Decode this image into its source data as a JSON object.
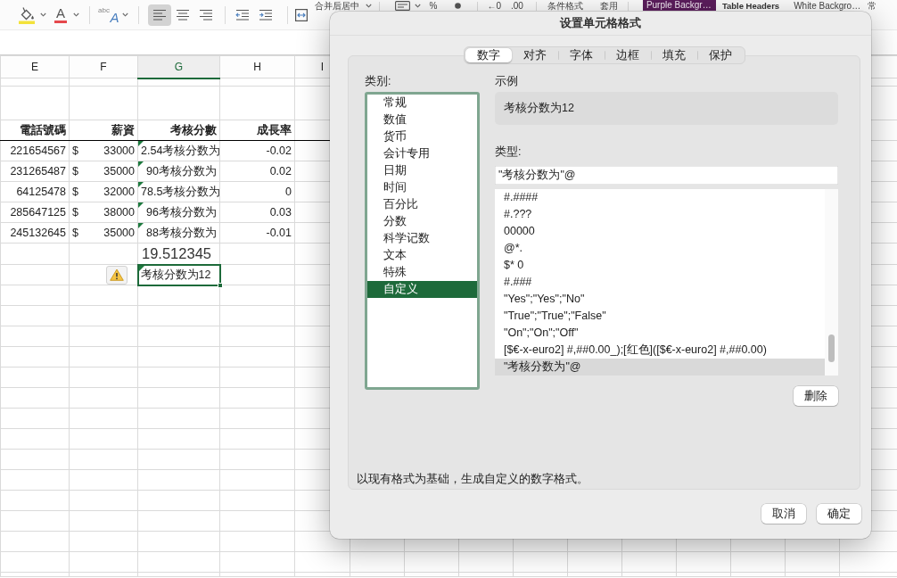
{
  "toolbar": {
    "font_color_glyph": "A",
    "orientation_glyphs": [
      "abc",
      "A"
    ],
    "align_buttons": [
      {
        "selected": true
      },
      {
        "selected": false
      },
      {
        "selected": false
      }
    ],
    "merge_label": "合并后居中",
    "percent_glyph": "%",
    "decimal_labels": [
      "←0",
      ".00"
    ],
    "conditional_format_label": "条件格式",
    "table_format_label": "套用",
    "cell_styles": [
      {
        "label": "Purple Backgr…",
        "kind": "filled"
      },
      {
        "label": "Table Headers",
        "kind": "bold"
      },
      {
        "label": "White Backgro…",
        "kind": "plain"
      },
      {
        "label": "常",
        "kind": "plain"
      }
    ]
  },
  "sheet": {
    "columns": [
      {
        "label": "E",
        "selected": false
      },
      {
        "label": "F",
        "selected": false
      },
      {
        "label": "G",
        "selected": true
      },
      {
        "label": "H",
        "selected": false
      },
      {
        "label": "I",
        "selected": false
      }
    ],
    "header_row": [
      "電話號碼",
      "薪資",
      "考核分數",
      "成長率"
    ],
    "rows": [
      {
        "phone": "221654567",
        "currency": "$",
        "salary": "33000",
        "score": "2.54考核分数为",
        "flagged": true,
        "growth": "-0.02"
      },
      {
        "phone": "231265487",
        "currency": "$",
        "salary": "35000",
        "score": "90考核分数为",
        "flagged": true,
        "growth": "0.02"
      },
      {
        "phone": "64125478",
        "currency": "$",
        "salary": "32000",
        "score": "78.5考核分数为",
        "flagged": true,
        "growth": "0"
      },
      {
        "phone": "285647125",
        "currency": "$",
        "salary": "38000",
        "score": "96考核分数为",
        "flagged": true,
        "growth": "0.03"
      },
      {
        "phone": "245132645",
        "currency": "$",
        "salary": "35000",
        "score": "88考核分数为",
        "flagged": true,
        "growth": "-0.01"
      }
    ],
    "average": "19.512345",
    "active_cell": {
      "text": "考核分数为12",
      "flagged": true,
      "warning": true
    }
  },
  "dialog": {
    "title": "设置单元格格式",
    "tabs": [
      {
        "label": "数字",
        "selected": true
      },
      {
        "label": "对齐",
        "selected": false
      },
      {
        "label": "字体",
        "selected": false
      },
      {
        "label": "边框",
        "selected": false
      },
      {
        "label": "填充",
        "selected": false
      },
      {
        "label": "保护",
        "selected": false
      }
    ],
    "category_label": "类别:",
    "categories": [
      {
        "label": "常规",
        "selected": false
      },
      {
        "label": "数值",
        "selected": false
      },
      {
        "label": "货币",
        "selected": false
      },
      {
        "label": "会计专用",
        "selected": false
      },
      {
        "label": "日期",
        "selected": false
      },
      {
        "label": "时间",
        "selected": false
      },
      {
        "label": "百分比",
        "selected": false
      },
      {
        "label": "分数",
        "selected": false
      },
      {
        "label": "科学记数",
        "selected": false
      },
      {
        "label": "文本",
        "selected": false
      },
      {
        "label": "特殊",
        "selected": false
      },
      {
        "label": "自定义",
        "selected": true
      }
    ],
    "sample_label": "示例",
    "sample": "考核分数为12",
    "type_label": "类型:",
    "type_value": "\"考核分数为\"@",
    "formats": [
      {
        "label": "#.####",
        "selected": false
      },
      {
        "label": "#.???",
        "selected": false
      },
      {
        "label": "00000",
        "selected": false
      },
      {
        "label": "@*.",
        "selected": false
      },
      {
        "label": "$* 0",
        "selected": false
      },
      {
        "label": "#.###",
        "selected": false
      },
      {
        "label": "\"Yes\";\"Yes\";\"No\"",
        "selected": false
      },
      {
        "label": "\"True\";\"True\";\"False\"",
        "selected": false
      },
      {
        "label": "\"On\";\"On\";\"Off\"",
        "selected": false
      },
      {
        "label": "[$€-x-euro2] #,##0.00_);[红色]([$€-x-euro2] #,##0.00)",
        "selected": false
      },
      {
        "label": "\"考核分数为\"@",
        "selected": true
      }
    ],
    "delete_button": "删除",
    "description": "以现有格式为基础，生成自定义的数字格式。",
    "buttons": [
      "取消",
      "确定"
    ]
  }
}
